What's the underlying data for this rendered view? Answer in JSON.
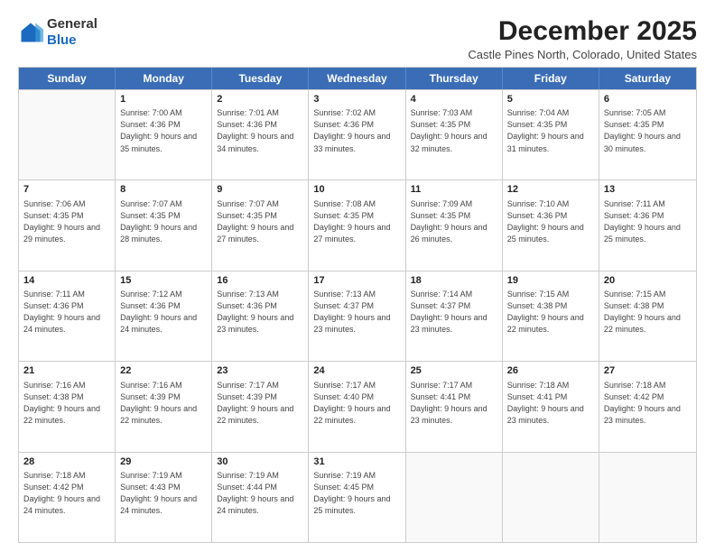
{
  "header": {
    "logo_line1": "General",
    "logo_line2": "Blue",
    "month": "December 2025",
    "location": "Castle Pines North, Colorado, United States"
  },
  "weekdays": [
    "Sunday",
    "Monday",
    "Tuesday",
    "Wednesday",
    "Thursday",
    "Friday",
    "Saturday"
  ],
  "rows": [
    [
      {
        "day": "",
        "sunrise": "",
        "sunset": "",
        "daylight": "",
        "empty": true
      },
      {
        "day": "1",
        "sunrise": "Sunrise: 7:00 AM",
        "sunset": "Sunset: 4:36 PM",
        "daylight": "Daylight: 9 hours and 35 minutes."
      },
      {
        "day": "2",
        "sunrise": "Sunrise: 7:01 AM",
        "sunset": "Sunset: 4:36 PM",
        "daylight": "Daylight: 9 hours and 34 minutes."
      },
      {
        "day": "3",
        "sunrise": "Sunrise: 7:02 AM",
        "sunset": "Sunset: 4:36 PM",
        "daylight": "Daylight: 9 hours and 33 minutes."
      },
      {
        "day": "4",
        "sunrise": "Sunrise: 7:03 AM",
        "sunset": "Sunset: 4:35 PM",
        "daylight": "Daylight: 9 hours and 32 minutes."
      },
      {
        "day": "5",
        "sunrise": "Sunrise: 7:04 AM",
        "sunset": "Sunset: 4:35 PM",
        "daylight": "Daylight: 9 hours and 31 minutes."
      },
      {
        "day": "6",
        "sunrise": "Sunrise: 7:05 AM",
        "sunset": "Sunset: 4:35 PM",
        "daylight": "Daylight: 9 hours and 30 minutes."
      }
    ],
    [
      {
        "day": "7",
        "sunrise": "Sunrise: 7:06 AM",
        "sunset": "Sunset: 4:35 PM",
        "daylight": "Daylight: 9 hours and 29 minutes."
      },
      {
        "day": "8",
        "sunrise": "Sunrise: 7:07 AM",
        "sunset": "Sunset: 4:35 PM",
        "daylight": "Daylight: 9 hours and 28 minutes."
      },
      {
        "day": "9",
        "sunrise": "Sunrise: 7:07 AM",
        "sunset": "Sunset: 4:35 PM",
        "daylight": "Daylight: 9 hours and 27 minutes."
      },
      {
        "day": "10",
        "sunrise": "Sunrise: 7:08 AM",
        "sunset": "Sunset: 4:35 PM",
        "daylight": "Daylight: 9 hours and 27 minutes."
      },
      {
        "day": "11",
        "sunrise": "Sunrise: 7:09 AM",
        "sunset": "Sunset: 4:35 PM",
        "daylight": "Daylight: 9 hours and 26 minutes."
      },
      {
        "day": "12",
        "sunrise": "Sunrise: 7:10 AM",
        "sunset": "Sunset: 4:36 PM",
        "daylight": "Daylight: 9 hours and 25 minutes."
      },
      {
        "day": "13",
        "sunrise": "Sunrise: 7:11 AM",
        "sunset": "Sunset: 4:36 PM",
        "daylight": "Daylight: 9 hours and 25 minutes."
      }
    ],
    [
      {
        "day": "14",
        "sunrise": "Sunrise: 7:11 AM",
        "sunset": "Sunset: 4:36 PM",
        "daylight": "Daylight: 9 hours and 24 minutes."
      },
      {
        "day": "15",
        "sunrise": "Sunrise: 7:12 AM",
        "sunset": "Sunset: 4:36 PM",
        "daylight": "Daylight: 9 hours and 24 minutes."
      },
      {
        "day": "16",
        "sunrise": "Sunrise: 7:13 AM",
        "sunset": "Sunset: 4:36 PM",
        "daylight": "Daylight: 9 hours and 23 minutes."
      },
      {
        "day": "17",
        "sunrise": "Sunrise: 7:13 AM",
        "sunset": "Sunset: 4:37 PM",
        "daylight": "Daylight: 9 hours and 23 minutes."
      },
      {
        "day": "18",
        "sunrise": "Sunrise: 7:14 AM",
        "sunset": "Sunset: 4:37 PM",
        "daylight": "Daylight: 9 hours and 23 minutes."
      },
      {
        "day": "19",
        "sunrise": "Sunrise: 7:15 AM",
        "sunset": "Sunset: 4:38 PM",
        "daylight": "Daylight: 9 hours and 22 minutes."
      },
      {
        "day": "20",
        "sunrise": "Sunrise: 7:15 AM",
        "sunset": "Sunset: 4:38 PM",
        "daylight": "Daylight: 9 hours and 22 minutes."
      }
    ],
    [
      {
        "day": "21",
        "sunrise": "Sunrise: 7:16 AM",
        "sunset": "Sunset: 4:38 PM",
        "daylight": "Daylight: 9 hours and 22 minutes."
      },
      {
        "day": "22",
        "sunrise": "Sunrise: 7:16 AM",
        "sunset": "Sunset: 4:39 PM",
        "daylight": "Daylight: 9 hours and 22 minutes."
      },
      {
        "day": "23",
        "sunrise": "Sunrise: 7:17 AM",
        "sunset": "Sunset: 4:39 PM",
        "daylight": "Daylight: 9 hours and 22 minutes."
      },
      {
        "day": "24",
        "sunrise": "Sunrise: 7:17 AM",
        "sunset": "Sunset: 4:40 PM",
        "daylight": "Daylight: 9 hours and 22 minutes."
      },
      {
        "day": "25",
        "sunrise": "Sunrise: 7:17 AM",
        "sunset": "Sunset: 4:41 PM",
        "daylight": "Daylight: 9 hours and 23 minutes."
      },
      {
        "day": "26",
        "sunrise": "Sunrise: 7:18 AM",
        "sunset": "Sunset: 4:41 PM",
        "daylight": "Daylight: 9 hours and 23 minutes."
      },
      {
        "day": "27",
        "sunrise": "Sunrise: 7:18 AM",
        "sunset": "Sunset: 4:42 PM",
        "daylight": "Daylight: 9 hours and 23 minutes."
      }
    ],
    [
      {
        "day": "28",
        "sunrise": "Sunrise: 7:18 AM",
        "sunset": "Sunset: 4:42 PM",
        "daylight": "Daylight: 9 hours and 24 minutes."
      },
      {
        "day": "29",
        "sunrise": "Sunrise: 7:19 AM",
        "sunset": "Sunset: 4:43 PM",
        "daylight": "Daylight: 9 hours and 24 minutes."
      },
      {
        "day": "30",
        "sunrise": "Sunrise: 7:19 AM",
        "sunset": "Sunset: 4:44 PM",
        "daylight": "Daylight: 9 hours and 24 minutes."
      },
      {
        "day": "31",
        "sunrise": "Sunrise: 7:19 AM",
        "sunset": "Sunset: 4:45 PM",
        "daylight": "Daylight: 9 hours and 25 minutes."
      },
      {
        "day": "",
        "sunrise": "",
        "sunset": "",
        "daylight": "",
        "empty": true
      },
      {
        "day": "",
        "sunrise": "",
        "sunset": "",
        "daylight": "",
        "empty": true
      },
      {
        "day": "",
        "sunrise": "",
        "sunset": "",
        "daylight": "",
        "empty": true
      }
    ]
  ]
}
